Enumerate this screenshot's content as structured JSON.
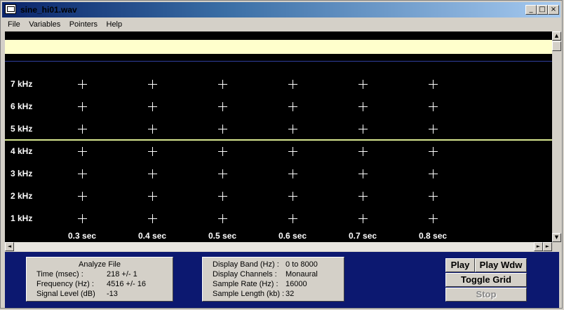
{
  "window": {
    "title": "sine_hi01.wav",
    "controls": [
      "_",
      "□",
      "×"
    ]
  },
  "menu": [
    "File",
    "Variables",
    "Pointers",
    "Help"
  ],
  "spectrogram": {
    "freq_labels": [
      "7  kHz",
      "6  kHz",
      "5  kHz",
      "4  kHz",
      "3  kHz",
      "2  kHz",
      "1  kHz"
    ],
    "time_labels": [
      "0.3 sec",
      "0.4 sec",
      "0.5 sec",
      "0.6 sec",
      "0.7 sec",
      "0.8 sec"
    ],
    "highlight_color": "#ffffcc",
    "marker_line_color": "#d8e890"
  },
  "analyze": {
    "title": "Analyze File",
    "rows": [
      {
        "key": "Time (msec) :",
        "value": "218  +/- 1"
      },
      {
        "key": "Frequency (Hz) :",
        "value": "4516 +/- 16"
      },
      {
        "key": "Signal Level (dB)",
        "value": "-13"
      }
    ]
  },
  "display": {
    "rows": [
      {
        "key": "Display Band (Hz) :",
        "value": "0 to 8000"
      },
      {
        "key": "Display Channels :",
        "value": "Monaural"
      },
      {
        "key": "Sample Rate (Hz) :",
        "value": "16000"
      },
      {
        "key": "Sample Length (kb) :",
        "value": "32"
      }
    ]
  },
  "buttons": {
    "play": "Play",
    "play_wdw": "Play Wdw",
    "toggle_grid": "Toggle Grid",
    "stop": "Stop"
  },
  "scrollbar": {
    "up": "▲",
    "down": "▼",
    "left": "◄",
    "right": "►"
  }
}
